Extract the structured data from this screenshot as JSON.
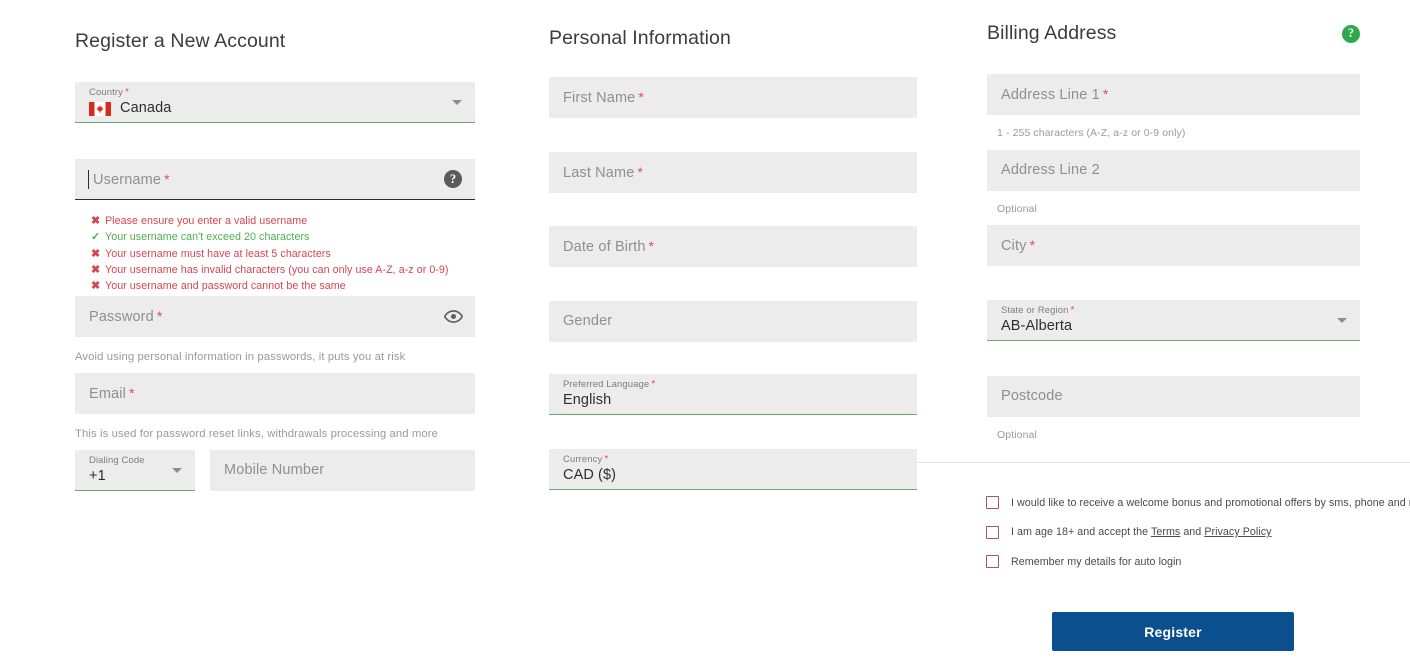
{
  "accent": {
    "primary_blue": "#0c4f8f",
    "field_bg": "#ececec",
    "valid_green": "#6aa86f",
    "error_red": "#d94452",
    "success_green": "#4caf50",
    "help_green": "#2faa4a",
    "checkbox_border": "#a85561"
  },
  "register_section": {
    "title": "Register a New Account",
    "country": {
      "label": "Country",
      "required_mark": "*",
      "value": "Canada",
      "flag": "canada-flag-icon",
      "dropdown_icon": "chevron-down-icon"
    },
    "username": {
      "placeholder": "Username",
      "required_mark": "*",
      "value": "",
      "help_icon": "help-icon",
      "validations": [
        {
          "status": "error",
          "mark": "✖",
          "text": "Please ensure you enter a valid username"
        },
        {
          "status": "success",
          "mark": "✓",
          "text": "Your username can't exceed 20 characters"
        },
        {
          "status": "error",
          "mark": "✖",
          "text": "Your username must have at least 5 characters"
        },
        {
          "status": "error",
          "mark": "✖",
          "text": "Your username has invalid characters (you can only use A-Z, a-z or 0-9)"
        },
        {
          "status": "error",
          "mark": "✖",
          "text": "Your username and password cannot be the same"
        }
      ]
    },
    "password": {
      "placeholder": "Password",
      "required_mark": "*",
      "value": "",
      "reveal_icon": "eye-icon",
      "helper": "Avoid using personal information in passwords, it puts you at risk"
    },
    "email": {
      "placeholder": "Email",
      "required_mark": "*",
      "value": "",
      "helper": "This is used for password reset links, withdrawals processing and more"
    },
    "dialing_code": {
      "label": "Dialing Code",
      "value": "+1",
      "dropdown_icon": "chevron-down-icon"
    },
    "mobile_number": {
      "placeholder": "Mobile Number",
      "value": ""
    }
  },
  "personal_section": {
    "title": "Personal Information",
    "first_name": {
      "placeholder": "First Name",
      "required_mark": "*",
      "value": ""
    },
    "last_name": {
      "placeholder": "Last Name",
      "required_mark": "*",
      "value": ""
    },
    "date_of_birth": {
      "placeholder": "Date of Birth",
      "required_mark": "*",
      "value": ""
    },
    "gender": {
      "placeholder": "Gender",
      "required_mark": "",
      "value": ""
    },
    "preferred_language": {
      "label": "Preferred Language",
      "required_mark": "*",
      "value": "English"
    },
    "currency": {
      "label": "Currency",
      "required_mark": "*",
      "value": "CAD ($)"
    }
  },
  "billing_section": {
    "title": "Billing Address",
    "help_icon": "help-icon",
    "address_line_1": {
      "placeholder": "Address Line 1",
      "required_mark": "*",
      "value": "",
      "helper": "1 - 255 characters (A-Z, a-z or 0-9 only)"
    },
    "address_line_2": {
      "placeholder": "Address Line 2",
      "required_mark": "",
      "value": "",
      "helper": "Optional"
    },
    "city": {
      "placeholder": "City",
      "required_mark": "*",
      "value": ""
    },
    "state_or_region": {
      "label": "State or Region",
      "required_mark": "*",
      "value": "AB-Alberta",
      "dropdown_icon": "chevron-down-icon"
    },
    "postcode": {
      "placeholder": "Postcode",
      "required_mark": "",
      "value": "",
      "helper": "Optional"
    },
    "checkboxes": [
      {
        "checked": false,
        "text": "I would like to receive a welcome bonus and promotional offers by sms, phone and mail"
      },
      {
        "checked": false,
        "text_before": "I am age 18+ and accept the ",
        "link1": "Terms",
        "text_middle": " and ",
        "link2": "Privacy Policy"
      },
      {
        "checked": false,
        "text": "Remember my details for auto login"
      }
    ],
    "submit_label": "Register"
  }
}
